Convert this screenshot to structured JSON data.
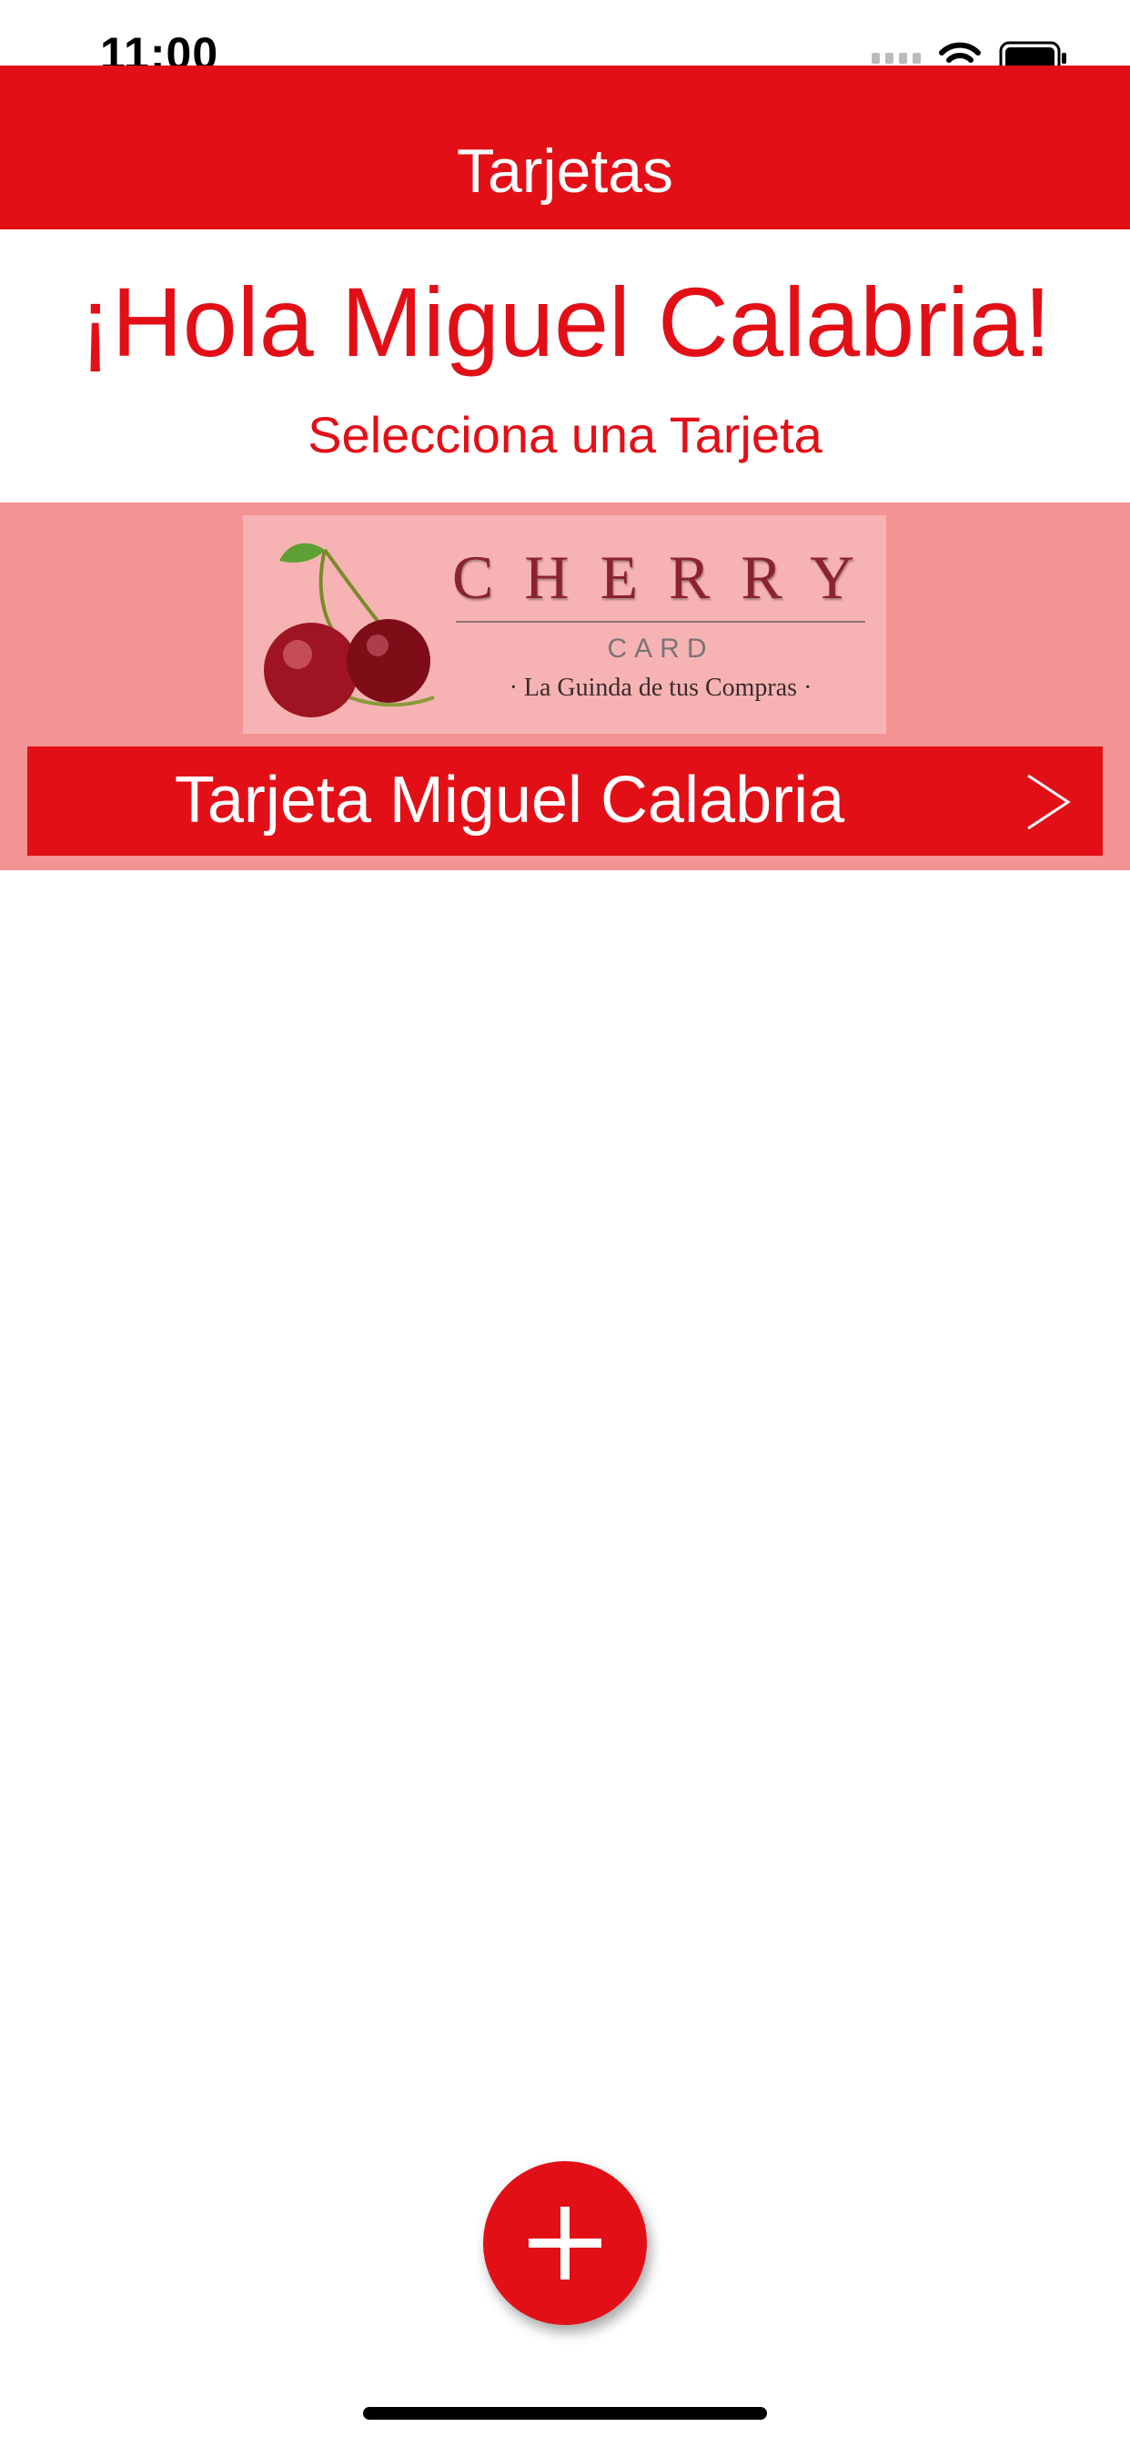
{
  "status_bar": {
    "time": "11:00"
  },
  "nav": {
    "title": "Tarjetas"
  },
  "greeting": "¡Hola Miguel Calabria!",
  "subtitle": "Selecciona una Tarjeta",
  "cards": [
    {
      "brand": "CHERRY",
      "brand_sub": "CARD",
      "tagline": "· La Guinda de tus Compras ·",
      "label": "Tarjeta Miguel Calabria"
    }
  ],
  "icons": {
    "wifi": "wifi-icon",
    "battery": "battery-icon",
    "chevron": "chevron-right-icon",
    "add": "plus-icon"
  },
  "colors": {
    "accent": "#e30f17",
    "card_cell_bg": "#f39394",
    "card_image_bg": "#f7b3b4"
  }
}
